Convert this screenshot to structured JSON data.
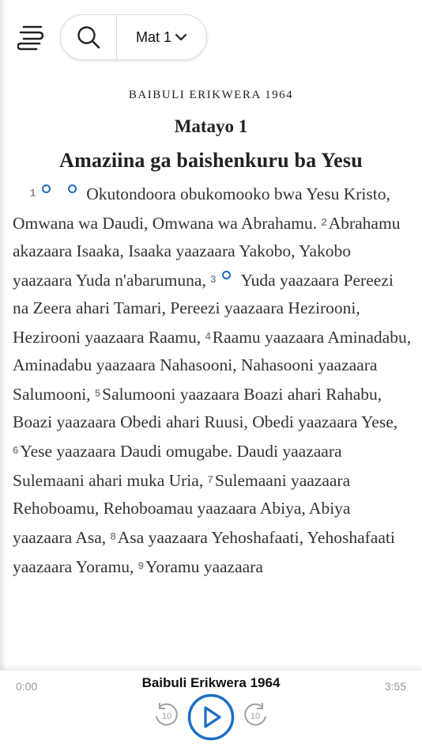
{
  "nav": {
    "reference": "Mat 1"
  },
  "content": {
    "version": "BAIBULI ERIKWERA 1964",
    "chapter_title": "Matayo 1",
    "section_heading": "Amaziina ga baishenkuru ba Yesu",
    "verses": [
      {
        "num": "1",
        "text": "Okutondoora obukomooko bwa Yesu Kristo, Omwana wa Daudi, Omwana wa Abrahamu. "
      },
      {
        "num": "2",
        "text": "Abrahamu akazaara Isaaka, Isaaka yaazaara Yakobo, Yakobo yaazaara Yuda n'abarumuna, "
      },
      {
        "num": "3",
        "text": "Yuda yaazaara Pereezi na Zeera ahari Tamari, Pereezi yaazaara Hezirooni, Hezirooni yaazaara Raamu, "
      },
      {
        "num": "4",
        "text": "Raamu yaazaara Aminadabu, Aminadabu yaazaara Nahasooni, Nahasooni yaazaara Salumooni, "
      },
      {
        "num": "5",
        "text": "Salumooni yaazaara Boazi ahari Rahabu, Boazi yaazaara Obedi ahari Ruusi, Obedi yaazaara Yese, "
      },
      {
        "num": "6",
        "text": "Yese yaazaara Daudi omugabe. Daudi yaazaara Sulemaani ahari muka Uria, "
      },
      {
        "num": "7",
        "text": "Sulemaani yaazaara Rehoboamu, Rehoboamau yaazaara Abiya, Abiya yaazaara Asa, "
      },
      {
        "num": "8",
        "text": "Asa yaazaara Yehoshafaati, Yehoshafaati yaazaara Yoramu, "
      },
      {
        "num": "9",
        "text": "Yoramu yaazaara"
      }
    ]
  },
  "audio": {
    "title": "Baibuli Erikwera 1964",
    "elapsed": "0:00",
    "duration": "3:55",
    "rewind_label": "10",
    "forward_label": "10"
  },
  "colors": {
    "accent": "#1b6fc4",
    "verse_number": "#8a8a8a"
  }
}
